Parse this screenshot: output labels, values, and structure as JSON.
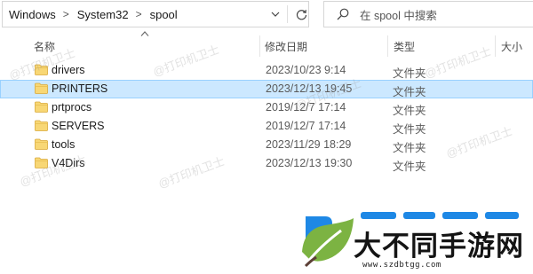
{
  "address_bar": {
    "breadcrumbs": [
      "Windows",
      "System32",
      "spool"
    ],
    "separator": ">"
  },
  "search": {
    "placeholder": "在 spool 中搜索"
  },
  "columns": {
    "name": "名称",
    "date_modified": "修改日期",
    "type": "类型",
    "size": "大小"
  },
  "files": [
    {
      "name": "drivers",
      "date": "2023/10/23 9:14",
      "type": "文件夹",
      "selected": false
    },
    {
      "name": "PRINTERS",
      "date": "2023/12/13 19:45",
      "type": "文件夹",
      "selected": true
    },
    {
      "name": "prtprocs",
      "date": "2019/12/7 17:14",
      "type": "文件夹",
      "selected": false
    },
    {
      "name": "SERVERS",
      "date": "2019/12/7 17:14",
      "type": "文件夹",
      "selected": false
    },
    {
      "name": "tools",
      "date": "2023/11/29 18:29",
      "type": "文件夹",
      "selected": false
    },
    {
      "name": "V4Dirs",
      "date": "2023/12/13 19:30",
      "type": "文件夹",
      "selected": false
    }
  ],
  "watermark": {
    "text": "@打印机卫士"
  },
  "logo": {
    "title": "大不同手游网",
    "url": "www.szdbtgg.com"
  },
  "colors": {
    "selection_bg": "#cce8ff",
    "selection_border": "#99d1ff",
    "folder_yellow": "#f8d775",
    "logo_blue": "#1e88e5",
    "logo_green": "#7cb342"
  },
  "icons": {
    "dropdown": "chevron-down-icon",
    "refresh": "refresh-icon",
    "search": "search-icon",
    "folder": "folder-icon",
    "sort": "sort-up-icon"
  }
}
